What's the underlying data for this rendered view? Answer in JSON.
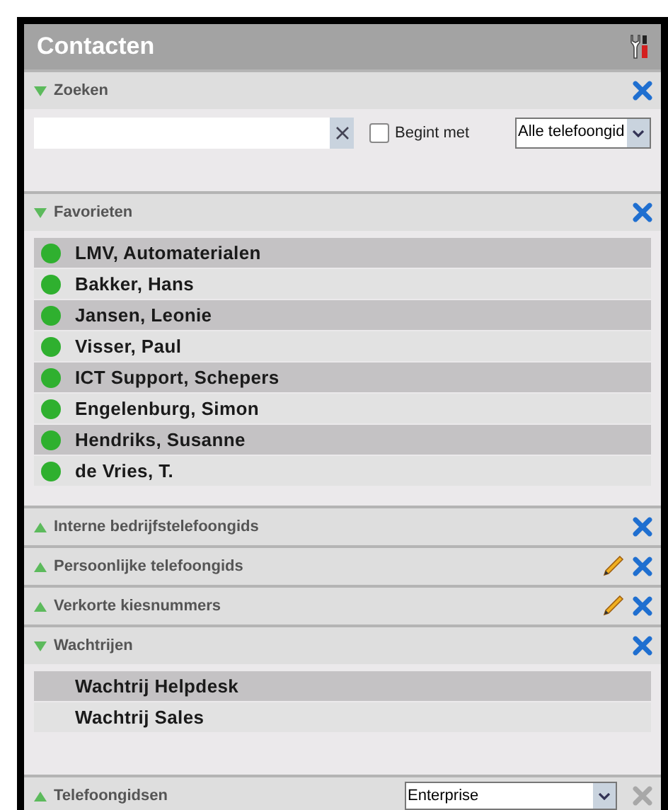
{
  "window": {
    "title": "Contacten"
  },
  "sections": [
    {
      "kind": "search",
      "title": "Zoeken",
      "expanded": true,
      "editable": false,
      "close_disabled": false,
      "match_start": {
        "label": "Begint met",
        "checked": false
      },
      "directory": {
        "value": "Alle telefoongid"
      }
    },
    {
      "kind": "contacts",
      "title": "Favorieten",
      "expanded": true,
      "editable": false,
      "close_disabled": false,
      "contacts": [
        {
          "name": "LMV, Automaterialen",
          "color": "#2fb02f"
        },
        {
          "name": "Bakker, Hans",
          "color": "#2fb02f"
        },
        {
          "name": "Jansen, Leonie",
          "color": "#2fb02f"
        },
        {
          "name": "Visser, Paul",
          "color": "#2fb02f"
        },
        {
          "name": "ICT Support, Schepers",
          "color": "#2fb02f"
        },
        {
          "name": "Engelenburg, Simon",
          "color": "#2fb02f"
        },
        {
          "name": "Hendriks, Susanne",
          "color": "#2fb02f"
        },
        {
          "name": "de Vries, T.",
          "color": "#2fb02f"
        }
      ]
    },
    {
      "kind": "plain",
      "title": "Interne bedrijfstelefoongids",
      "expanded": false,
      "editable": false,
      "close_disabled": false
    },
    {
      "kind": "plain",
      "title": "Persoonlijke telefoongids",
      "expanded": false,
      "editable": true,
      "close_disabled": false
    },
    {
      "kind": "plain",
      "title": "Verkorte kiesnummers",
      "expanded": false,
      "editable": true,
      "close_disabled": false
    },
    {
      "kind": "queues",
      "title": "Wachtrijen",
      "expanded": true,
      "editable": false,
      "close_disabled": false,
      "queues": [
        "Wachtrij Helpdesk",
        "Wachtrij Sales"
      ]
    },
    {
      "kind": "directory",
      "title": "Telefoongidsen",
      "expanded": false,
      "editable": false,
      "close_disabled": true,
      "directory": {
        "value": "Enterprise"
      }
    }
  ]
}
